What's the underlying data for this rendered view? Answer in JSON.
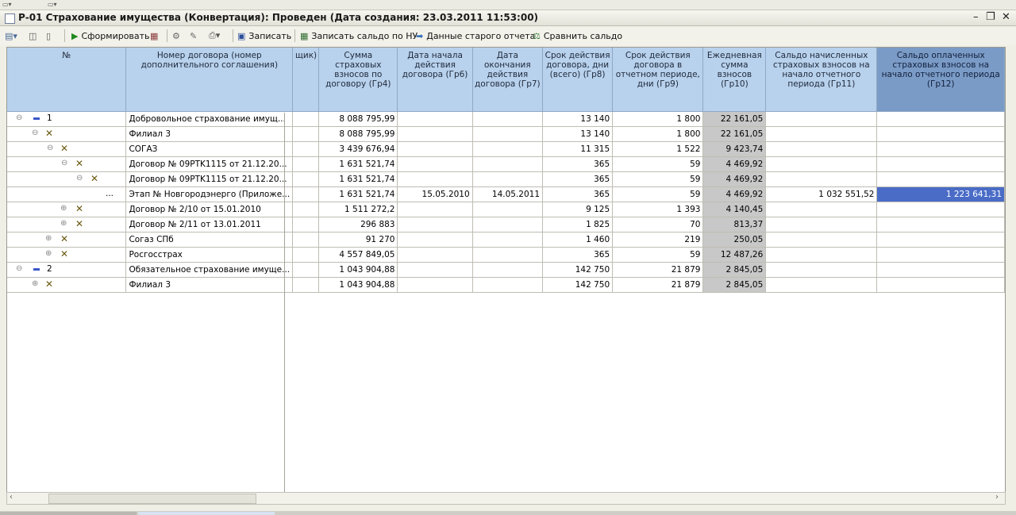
{
  "window": {
    "title": "Р-01 Страхование имущества (Конвертация): Проведен (Дата создания: 23.03.2011 11:53:00)"
  },
  "toolbar": {
    "form_label": "Сформировать",
    "save_label": "Записать",
    "save_balance_label": "Записать сальдо по НУ",
    "old_report_label": "Данные старого отчета",
    "compare_label": "Сравнить сальдо"
  },
  "columns": {
    "num": "№",
    "contract": "Номер договора (номер дополнительного соглашения)",
    "insurer": "щик)",
    "g4": "Сумма страховых взносов по договору (Гр4)",
    "g6": "Дата начала действия договора (Гр6)",
    "g7": "Дата окончания действия договора (Гр7)",
    "g8": "Срок действия договора, дни (всего) (Гр8)",
    "g9": "Срок действия договора в отчетном периоде, дни (Гр9)",
    "g10": "Ежедневная сумма взносов (Гр10)",
    "g11": "Сальдо начисленных страховых взносов на начало отчетного периода (Гр11)",
    "g12": "Сальдо оплаченных страховых взносов на начало отчетного периода (Гр12)"
  },
  "rows": [
    {
      "num": "1",
      "name": "Добровольное страхование имущ...",
      "g4": "8 088 795,99",
      "g6": "",
      "g7": "",
      "g8": "13 140",
      "g9": "1 800",
      "g10": "22 161,05",
      "g11": "",
      "g12": ""
    },
    {
      "num": "",
      "name": "Филиал 3",
      "g4": "8 088 795,99",
      "g6": "",
      "g7": "",
      "g8": "13 140",
      "g9": "1 800",
      "g10": "22 161,05",
      "g11": "",
      "g12": ""
    },
    {
      "num": "",
      "name": "СОГАЗ",
      "g4": "3 439 676,94",
      "g6": "",
      "g7": "",
      "g8": "11 315",
      "g9": "1 522",
      "g10": "9 423,74",
      "g11": "",
      "g12": ""
    },
    {
      "num": "",
      "name": "Договор № 09PTK1115 от 21.12.20...",
      "g4": "1 631 521,74",
      "g6": "",
      "g7": "",
      "g8": "365",
      "g9": "59",
      "g10": "4 469,92",
      "g11": "",
      "g12": ""
    },
    {
      "num": "",
      "name": "Договор № 09PTK1115 от 21.12.20...",
      "g4": "1 631 521,74",
      "g6": "",
      "g7": "",
      "g8": "365",
      "g9": "59",
      "g10": "4 469,92",
      "g11": "",
      "g12": ""
    },
    {
      "num": "...",
      "name": "Этап № Новгородэнерго (Приложе...",
      "g4": "1 631 521,74",
      "g6": "15.05.2010",
      "g7": "14.05.2011",
      "g8": "365",
      "g9": "59",
      "g10": "4 469,92",
      "g11": "1 032 551,52",
      "g12": "1 223 641,31"
    },
    {
      "num": "",
      "name": "Договор № 2/10 от 15.01.2010",
      "g4": "1 511 272,2",
      "g6": "",
      "g7": "",
      "g8": "9 125",
      "g9": "1 393",
      "g10": "4 140,45",
      "g11": "",
      "g12": ""
    },
    {
      "num": "",
      "name": "Договор № 2/11 от 13.01.2011",
      "g4": "296 883",
      "g6": "",
      "g7": "",
      "g8": "1 825",
      "g9": "70",
      "g10": "813,37",
      "g11": "",
      "g12": ""
    },
    {
      "num": "",
      "name": "Согаз СПб",
      "g4": "91 270",
      "g6": "",
      "g7": "",
      "g8": "1 460",
      "g9": "219",
      "g10": "250,05",
      "g11": "",
      "g12": ""
    },
    {
      "num": "",
      "name": "Росгосстрах",
      "g4": "4 557 849,05",
      "g6": "",
      "g7": "",
      "g8": "365",
      "g9": "59",
      "g10": "12 487,26",
      "g11": "",
      "g12": ""
    },
    {
      "num": "2",
      "name": "Обязательное страхование имуще...",
      "g4": "1 043 904,88",
      "g6": "",
      "g7": "",
      "g8": "142 750",
      "g9": "21 879",
      "g10": "2 845,05",
      "g11": "",
      "g12": ""
    },
    {
      "num": "",
      "name": "Филиал 3",
      "g4": "1 043 904,88",
      "g6": "",
      "g7": "",
      "g8": "142 750",
      "g9": "21 879",
      "g10": "2 845,05",
      "g11": "",
      "g12": ""
    }
  ]
}
